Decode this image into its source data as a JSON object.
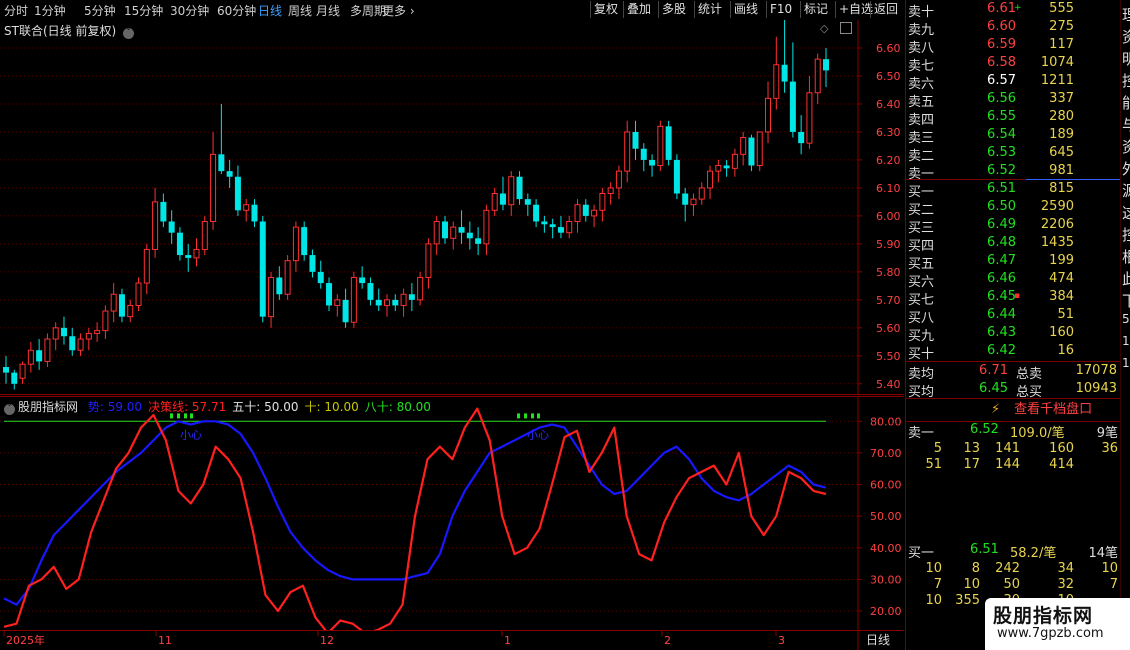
{
  "toolbar": {
    "periods": [
      "分时",
      "1分钟",
      "5分钟",
      "15分钟",
      "30分钟",
      "60分钟",
      "日线",
      "周线",
      "月线",
      "多周期",
      "更多 ›"
    ],
    "active_period": "日线",
    "buttons": [
      "复权",
      "叠加",
      "多股",
      "统计",
      "画线",
      "F10",
      "标记",
      "+自选",
      "返回"
    ]
  },
  "main_chart": {
    "title": "ST联合(日线 前复权)",
    "price_ticks": [
      "6.60",
      "6.50",
      "6.40",
      "6.30",
      "6.20",
      "6.10",
      "6.00",
      "5.90",
      "5.80",
      "5.70",
      "5.60",
      "5.50",
      "5.40"
    ]
  },
  "sub_chart": {
    "title": "股朋指标网",
    "indicators": [
      {
        "label": "势: 59.00",
        "color": "#2020ff"
      },
      {
        "label": "决策线: 57.71",
        "color": "#ff2020"
      },
      {
        "label": "五十: 50.00",
        "color": "#e0e0e0"
      },
      {
        "label": "十: 10.00",
        "color": "#c8c800"
      },
      {
        "label": "八十: 80.00",
        "color": "#20e020"
      }
    ],
    "ticks": [
      "80.00",
      "70.00",
      "60.00",
      "50.00",
      "40.00",
      "30.00",
      "20.00"
    ],
    "annotations": [
      "小心",
      "小心"
    ]
  },
  "time_axis": {
    "labels": [
      "2025年",
      "11",
      "12",
      "1",
      "2",
      "3"
    ],
    "period_label": "日线"
  },
  "chart_data": [
    {
      "type": "candlestick",
      "title": "ST联合(日线 前复权)",
      "ylim": [
        5.36,
        6.7
      ],
      "ohlc": [
        [
          5.46,
          5.5,
          5.4,
          5.44
        ],
        [
          5.44,
          5.45,
          5.38,
          5.4
        ],
        [
          5.42,
          5.48,
          5.4,
          5.47
        ],
        [
          5.47,
          5.55,
          5.44,
          5.52
        ],
        [
          5.52,
          5.56,
          5.45,
          5.48
        ],
        [
          5.48,
          5.58,
          5.46,
          5.56
        ],
        [
          5.56,
          5.62,
          5.52,
          5.6
        ],
        [
          5.6,
          5.64,
          5.54,
          5.57
        ],
        [
          5.57,
          5.6,
          5.5,
          5.52
        ],
        [
          5.52,
          5.58,
          5.5,
          5.56
        ],
        [
          5.56,
          5.6,
          5.52,
          5.58
        ],
        [
          5.58,
          5.62,
          5.55,
          5.59
        ],
        [
          5.59,
          5.68,
          5.56,
          5.66
        ],
        [
          5.66,
          5.76,
          5.62,
          5.72
        ],
        [
          5.72,
          5.74,
          5.62,
          5.64
        ],
        [
          5.64,
          5.7,
          5.62,
          5.68
        ],
        [
          5.68,
          5.78,
          5.66,
          5.76
        ],
        [
          5.76,
          5.9,
          5.72,
          5.88
        ],
        [
          5.88,
          6.1,
          5.85,
          6.05
        ],
        [
          6.05,
          6.08,
          5.96,
          5.98
        ],
        [
          5.98,
          6.02,
          5.9,
          5.94
        ],
        [
          5.94,
          5.96,
          5.84,
          5.86
        ],
        [
          5.86,
          5.9,
          5.8,
          5.85
        ],
        [
          5.85,
          5.92,
          5.82,
          5.88
        ],
        [
          5.88,
          6.0,
          5.86,
          5.98
        ],
        [
          5.98,
          6.3,
          5.95,
          6.22
        ],
        [
          6.22,
          6.4,
          6.15,
          6.16
        ],
        [
          6.16,
          6.2,
          6.1,
          6.14
        ],
        [
          6.14,
          6.18,
          6.0,
          6.02
        ],
        [
          6.02,
          6.06,
          5.98,
          6.04
        ],
        [
          6.04,
          6.06,
          5.96,
          5.98
        ],
        [
          5.98,
          6.0,
          5.62,
          5.64
        ],
        [
          5.64,
          5.8,
          5.6,
          5.78
        ],
        [
          5.78,
          5.82,
          5.7,
          5.72
        ],
        [
          5.72,
          5.86,
          5.7,
          5.84
        ],
        [
          5.84,
          5.98,
          5.8,
          5.96
        ],
        [
          5.96,
          5.98,
          5.84,
          5.86
        ],
        [
          5.86,
          5.88,
          5.78,
          5.8
        ],
        [
          5.8,
          5.84,
          5.74,
          5.76
        ],
        [
          5.76,
          5.78,
          5.66,
          5.68
        ],
        [
          5.68,
          5.72,
          5.64,
          5.7
        ],
        [
          5.7,
          5.74,
          5.6,
          5.62
        ],
        [
          5.62,
          5.8,
          5.6,
          5.78
        ],
        [
          5.78,
          5.82,
          5.74,
          5.76
        ],
        [
          5.76,
          5.78,
          5.68,
          5.7
        ],
        [
          5.7,
          5.74,
          5.66,
          5.68
        ],
        [
          5.68,
          5.72,
          5.64,
          5.7
        ],
        [
          5.7,
          5.72,
          5.66,
          5.68
        ],
        [
          5.68,
          5.74,
          5.64,
          5.72
        ],
        [
          5.72,
          5.76,
          5.66,
          5.7
        ],
        [
          5.7,
          5.8,
          5.68,
          5.78
        ],
        [
          5.78,
          5.92,
          5.74,
          5.9
        ],
        [
          5.9,
          6.0,
          5.86,
          5.98
        ],
        [
          5.98,
          6.0,
          5.9,
          5.92
        ],
        [
          5.92,
          5.98,
          5.88,
          5.96
        ],
        [
          5.96,
          6.02,
          5.9,
          5.94
        ],
        [
          5.94,
          5.98,
          5.88,
          5.92
        ],
        [
          5.92,
          5.96,
          5.86,
          5.9
        ],
        [
          5.9,
          6.04,
          5.86,
          6.02
        ],
        [
          6.02,
          6.1,
          6.0,
          6.08
        ],
        [
          6.08,
          6.14,
          6.02,
          6.04
        ],
        [
          6.04,
          6.16,
          6.0,
          6.14
        ],
        [
          6.14,
          6.16,
          6.04,
          6.06
        ],
        [
          6.06,
          6.08,
          6.0,
          6.04
        ],
        [
          6.04,
          6.06,
          5.96,
          5.98
        ],
        [
          5.98,
          6.0,
          5.94,
          5.97
        ],
        [
          5.97,
          5.99,
          5.92,
          5.96
        ],
        [
          5.96,
          6.0,
          5.92,
          5.94
        ],
        [
          5.94,
          6.0,
          5.92,
          5.98
        ],
        [
          5.98,
          6.06,
          5.94,
          6.04
        ],
        [
          6.04,
          6.06,
          5.98,
          6.0
        ],
        [
          6.0,
          6.04,
          5.96,
          6.02
        ],
        [
          6.02,
          6.1,
          5.98,
          6.08
        ],
        [
          6.08,
          6.12,
          6.04,
          6.1
        ],
        [
          6.1,
          6.18,
          6.06,
          6.16
        ],
        [
          6.16,
          6.34,
          6.12,
          6.3
        ],
        [
          6.3,
          6.34,
          6.2,
          6.24
        ],
        [
          6.24,
          6.26,
          6.16,
          6.2
        ],
        [
          6.2,
          6.22,
          6.14,
          6.18
        ],
        [
          6.18,
          6.34,
          6.16,
          6.32
        ],
        [
          6.32,
          6.34,
          6.18,
          6.2
        ],
        [
          6.2,
          6.22,
          6.06,
          6.08
        ],
        [
          6.08,
          6.1,
          5.98,
          6.04
        ],
        [
          6.04,
          6.08,
          6.0,
          6.06
        ],
        [
          6.06,
          6.12,
          6.04,
          6.1
        ],
        [
          6.1,
          6.18,
          6.06,
          6.16
        ],
        [
          6.16,
          6.2,
          6.12,
          6.18
        ],
        [
          6.18,
          6.2,
          6.14,
          6.17
        ],
        [
          6.17,
          6.24,
          6.14,
          6.22
        ],
        [
          6.22,
          6.3,
          6.18,
          6.28
        ],
        [
          6.28,
          6.29,
          6.16,
          6.18
        ],
        [
          6.18,
          6.3,
          6.16,
          6.3
        ],
        [
          6.3,
          6.48,
          6.26,
          6.42
        ],
        [
          6.42,
          6.64,
          6.38,
          6.54
        ],
        [
          6.54,
          6.72,
          6.44,
          6.48
        ],
        [
          6.48,
          6.62,
          6.28,
          6.3
        ],
        [
          6.3,
          6.36,
          6.22,
          6.26
        ],
        [
          6.26,
          6.5,
          6.24,
          6.44
        ],
        [
          6.44,
          6.58,
          6.4,
          6.56
        ],
        [
          6.56,
          6.6,
          6.46,
          6.52
        ]
      ],
      "up_color": "#ff3030",
      "down_color": "#00e5e5"
    },
    {
      "type": "line",
      "title": "股朋指标网",
      "ylim": [
        14,
        88
      ],
      "series": [
        {
          "name": "势",
          "color": "#1818ff",
          "values": [
            24,
            22,
            27,
            36,
            44,
            48,
            52,
            56,
            60,
            64,
            67,
            70,
            74,
            78,
            80,
            79,
            80,
            80,
            79,
            76,
            70,
            62,
            53,
            45,
            40,
            36,
            33,
            31,
            30,
            30,
            30,
            30,
            30,
            31,
            32,
            38,
            50,
            58,
            64,
            70,
            72,
            74,
            76,
            78,
            79,
            78,
            72,
            66,
            60,
            57,
            58,
            62,
            66,
            70,
            72,
            68,
            62,
            58,
            56,
            55,
            57,
            60,
            63,
            66,
            64,
            60,
            59
          ]
        },
        {
          "name": "决策线",
          "color": "#ff2020",
          "values": [
            15,
            16,
            28,
            30,
            34,
            27,
            30,
            45,
            55,
            65,
            70,
            78,
            82,
            74,
            58,
            54,
            60,
            72,
            68,
            62,
            45,
            25,
            20,
            26,
            28,
            18,
            13,
            17,
            16,
            13,
            14,
            16,
            22,
            50,
            68,
            72,
            68,
            78,
            84,
            74,
            50,
            38,
            40,
            46,
            60,
            75,
            77,
            64,
            70,
            78,
            50,
            38,
            36,
            48,
            56,
            62,
            64,
            66,
            60,
            70,
            50,
            44,
            50,
            64,
            62,
            58,
            57
          ]
        }
      ],
      "reference_lines": [
        {
          "name": "八十",
          "value": 80,
          "color": "#20e020"
        },
        {
          "name": "十",
          "value": 10,
          "color": "#c8c800"
        }
      ]
    }
  ],
  "orderbook": {
    "sell": [
      {
        "label": "卖十",
        "price": "6.61",
        "vol": "555",
        "mark": "+",
        "price_color": "#ff4040"
      },
      {
        "label": "卖九",
        "price": "6.60",
        "vol": "275",
        "mark": "",
        "price_color": "#ff4040"
      },
      {
        "label": "卖八",
        "price": "6.59",
        "vol": "117",
        "mark": "",
        "price_color": "#ff4040"
      },
      {
        "label": "卖七",
        "price": "6.58",
        "vol": "1074",
        "mark": "",
        "price_color": "#ff4040"
      },
      {
        "label": "卖六",
        "price": "6.57",
        "vol": "1211",
        "mark": "",
        "price_color": "#ffffff"
      },
      {
        "label": "卖五",
        "price": "6.56",
        "vol": "337",
        "mark": "",
        "price_color": "#20e020"
      },
      {
        "label": "卖四",
        "price": "6.55",
        "vol": "280",
        "mark": "",
        "price_color": "#20e020"
      },
      {
        "label": "卖三",
        "price": "6.54",
        "vol": "189",
        "mark": "",
        "price_color": "#20e020"
      },
      {
        "label": "卖二",
        "price": "6.53",
        "vol": "645",
        "mark": "",
        "price_color": "#20e020"
      },
      {
        "label": "卖一",
        "price": "6.52",
        "vol": "981",
        "mark": "",
        "price_color": "#20e020"
      }
    ],
    "buy": [
      {
        "label": "买一",
        "price": "6.51",
        "vol": "815",
        "mark": "",
        "price_color": "#20e020"
      },
      {
        "label": "买二",
        "price": "6.50",
        "vol": "2590",
        "mark": "",
        "price_color": "#20e020"
      },
      {
        "label": "买三",
        "price": "6.49",
        "vol": "2206",
        "mark": "",
        "price_color": "#20e020"
      },
      {
        "label": "买四",
        "price": "6.48",
        "vol": "1435",
        "mark": "",
        "price_color": "#20e020"
      },
      {
        "label": "买五",
        "price": "6.47",
        "vol": "199",
        "mark": "",
        "price_color": "#20e020"
      },
      {
        "label": "买六",
        "price": "6.46",
        "vol": "474",
        "mark": "",
        "price_color": "#20e020"
      },
      {
        "label": "买七",
        "price": "6.45",
        "vol": "384",
        "mark": "▪",
        "price_color": "#20e020"
      },
      {
        "label": "买八",
        "price": "6.44",
        "vol": "51",
        "mark": "",
        "price_color": "#20e020"
      },
      {
        "label": "买九",
        "price": "6.43",
        "vol": "160",
        "mark": "",
        "price_color": "#20e020"
      },
      {
        "label": "买十",
        "price": "6.42",
        "vol": "16",
        "mark": "",
        "price_color": "#20e020"
      }
    ],
    "avg_sell": {
      "label": "卖均",
      "price": "6.71",
      "total_label": "总卖",
      "total": "17078"
    },
    "avg_buy": {
      "label": "买均",
      "price": "6.45",
      "total_label": "总买",
      "total": "10943"
    },
    "thousand_btn": "查看千档盘口",
    "queue_sell": {
      "label": "卖一",
      "price": "6.52",
      "avg": "109.0/笔",
      "count": "9笔"
    },
    "queue_sell_rows": [
      [
        "5",
        "13",
        "141",
        "160",
        "36"
      ],
      [
        "51",
        "17",
        "144",
        "414",
        ""
      ]
    ],
    "queue_buy": {
      "label": "买一",
      "price": "6.51",
      "avg": "58.2/笔",
      "count": "14笔"
    },
    "queue_buy_rows": [
      [
        "10",
        "8",
        "242",
        "34",
        "10"
      ],
      [
        "7",
        "10",
        "50",
        "32",
        "7"
      ],
      [
        "10",
        "355",
        "30",
        "10",
        ""
      ]
    ]
  },
  "side_clip": [
    "理",
    "资",
    "明",
    "控",
    "能",
    "与",
    "资",
    "外",
    "源",
    "这",
    "控",
    "根",
    "此",
    "下",
    "5",
    "1",
    "1"
  ],
  "watermark": {
    "title": "股朋指标网",
    "url": "www.7gpzb.com"
  }
}
